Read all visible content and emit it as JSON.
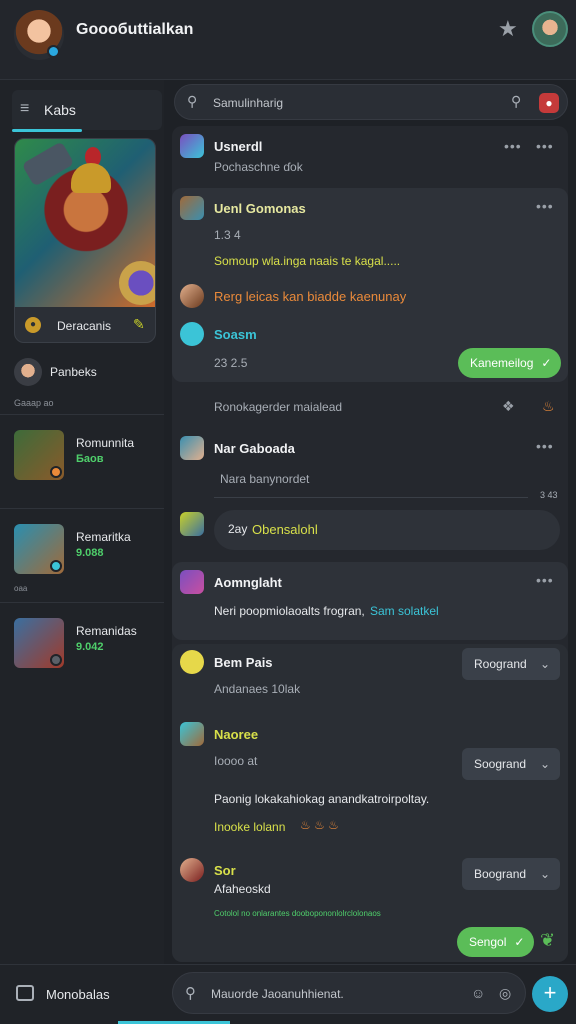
{
  "app": {
    "title": "Gooобuttialkan"
  },
  "sidebar": {
    "tab_label": "Kabs",
    "hero_label": "Deracanis",
    "user": {
      "name": "Panbeks",
      "meta": "Gaaap  ao"
    },
    "items": [
      {
        "title": "Romunnita",
        "sub": "Баов"
      },
      {
        "title": "Remaritka",
        "sub": "9.088"
      },
      {
        "title": "Remanidas",
        "sub": "9.042"
      }
    ],
    "item2_tiny": "oaa"
  },
  "search": {
    "placeholder": "Samulinharig"
  },
  "messages": {
    "m1": {
      "name": "Usnerdl",
      "sub": "Pochaschne ɗok"
    },
    "m2": {
      "name": "Uenl Gomonas",
      "meta": "1.3  4",
      "text": "Somoup wla.inga naais te kagal.....",
      "line2": "Rerg leicas kan biadde kaenunay"
    },
    "m3": {
      "name": "Soasm",
      "meta": "23 2.5",
      "button": "Kanemeilog"
    },
    "system": {
      "text": "Ronokagerder maialead"
    },
    "m4": {
      "name": "Nar Gaboada",
      "text": "Nara banynordet",
      "meta": "3 43"
    },
    "m5": {
      "prefix": "2ay",
      "name": "Obensalohl"
    },
    "m6": {
      "name": "Aomnglaht",
      "text": "Neri poopmiolaoalts frogran,",
      "link": "Sam solatkel"
    },
    "m7": {
      "name": "Bem Pais",
      "text": "Andanaes 10lak",
      "button": "Roogrand"
    },
    "m8": {
      "name": "Naoree",
      "text": "Ioooo at",
      "button": "Soogrand",
      "line2": "Paonig lokakahiokag anandkatroirpoltay.",
      "line3": "Inooke lolann"
    },
    "m9": {
      "name": "Sor",
      "text": "Afaheoskd",
      "button": "Boogrand",
      "tiny": "Cotolol no onlarantes doobopononlolrclolonaos",
      "send_button": "Sengol"
    }
  },
  "composer": {
    "placeholder": "Mauorde Jaoanuhhienat."
  },
  "bottombar": {
    "label": "Monobalas"
  }
}
